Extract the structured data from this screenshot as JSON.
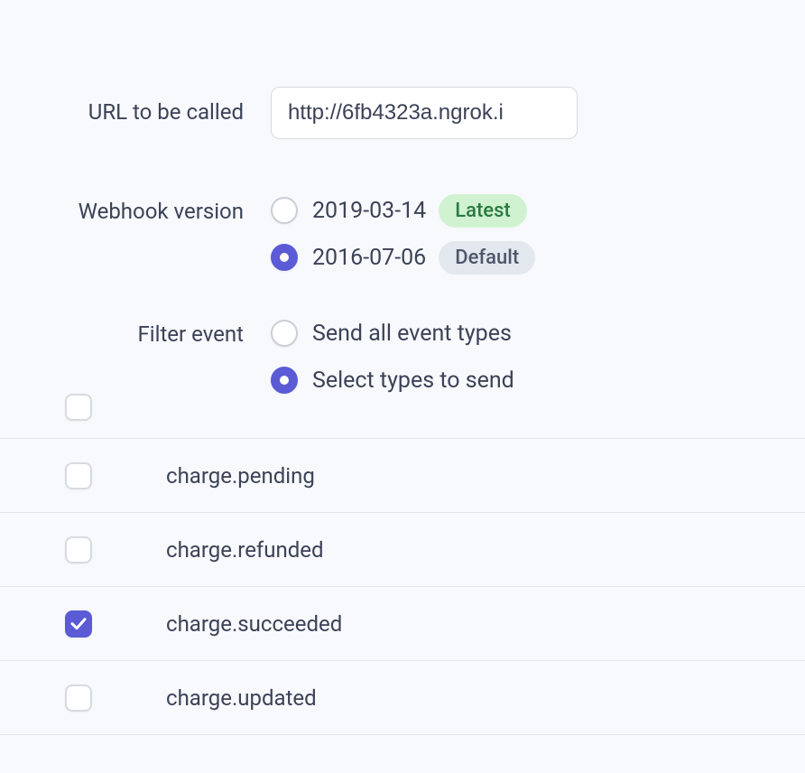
{
  "form": {
    "url": {
      "label": "URL to be called",
      "value": "http://6fb4323a.ngrok.i"
    },
    "version": {
      "label": "Webhook version",
      "options": [
        {
          "value": "2019-03-14",
          "badge_text": "Latest",
          "badge_kind": "latest",
          "selected": false
        },
        {
          "value": "2016-07-06",
          "badge_text": "Default",
          "badge_kind": "default",
          "selected": true
        }
      ]
    },
    "filter": {
      "label": "Filter event",
      "options": [
        {
          "value": "Send all event types",
          "selected": false
        },
        {
          "value": "Select types to send",
          "selected": true
        }
      ]
    }
  },
  "events": [
    {
      "name": "",
      "checked": false,
      "partial": true
    },
    {
      "name": "charge.pending",
      "checked": false
    },
    {
      "name": "charge.refunded",
      "checked": false
    },
    {
      "name": "charge.succeeded",
      "checked": true
    },
    {
      "name": "charge.updated",
      "checked": false
    }
  ]
}
